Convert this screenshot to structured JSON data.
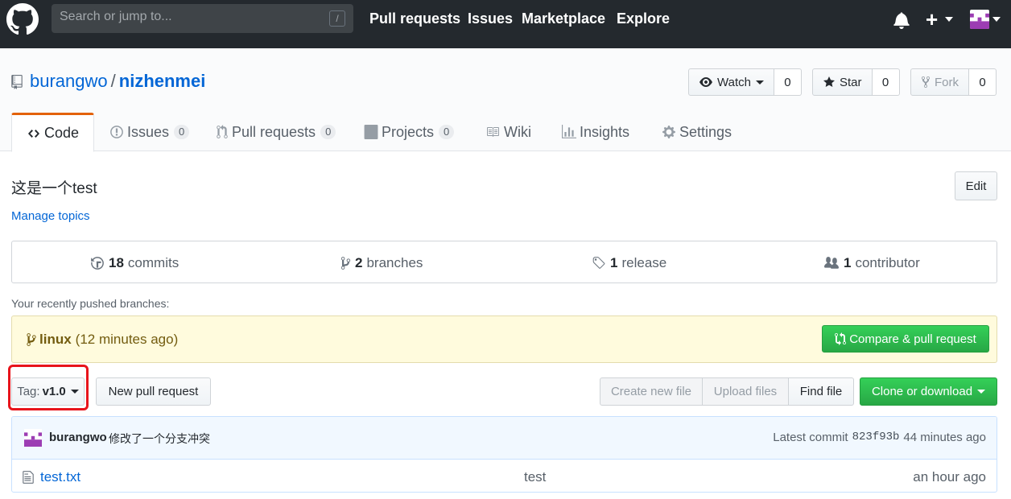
{
  "header": {
    "search_placeholder": "Search or jump to...",
    "search_key_hint": "/",
    "nav": [
      "Pull requests",
      "Issues",
      "Marketplace",
      "Explore"
    ],
    "plus_label": "+"
  },
  "repo": {
    "owner": "burangwo",
    "separator": "/",
    "name": "nizhenmei",
    "watch_label": "Watch",
    "watch_count": "0",
    "star_label": "Star",
    "star_count": "0",
    "fork_label": "Fork",
    "fork_count": "0"
  },
  "tabs": [
    {
      "label": "Code"
    },
    {
      "label": "Issues",
      "count": "0"
    },
    {
      "label": "Pull requests",
      "count": "0"
    },
    {
      "label": "Projects",
      "count": "0"
    },
    {
      "label": "Wiki"
    },
    {
      "label": "Insights"
    },
    {
      "label": "Settings"
    }
  ],
  "description": "这是一个test",
  "manage_topics": "Manage topics",
  "edit_label": "Edit",
  "summary": {
    "commits_num": "18",
    "commits_label": "commits",
    "branches_num": "2",
    "branches_label": "branches",
    "release_num": "1",
    "release_label": "release",
    "contributor_num": "1",
    "contributor_label": "contributor"
  },
  "recent_label": "Your recently pushed branches:",
  "flash": {
    "branch": "linux",
    "time": "(12 minutes ago)",
    "compare_label": "Compare & pull request"
  },
  "filenav": {
    "tag_prefix": "Tag:",
    "tag_value": "v1.0",
    "new_pr_label": "New pull request",
    "create_file": "Create new file",
    "upload_files": "Upload files",
    "find_file": "Find file",
    "clone_label": "Clone or download"
  },
  "commit": {
    "author": "burangwo",
    "message": "修改了一个分支冲突",
    "latest_label": "Latest commit",
    "sha": "823f93b",
    "age": "44 minutes ago"
  },
  "files": [
    {
      "name": "test.txt",
      "message": "test",
      "age": "an hour ago"
    }
  ],
  "colors": {
    "header_bg": "#24292e",
    "link": "#0366d6",
    "green": "#28a745",
    "flash_bg": "#fffbdd",
    "highlight": "#e8141b",
    "tab_accent": "#e36209"
  }
}
